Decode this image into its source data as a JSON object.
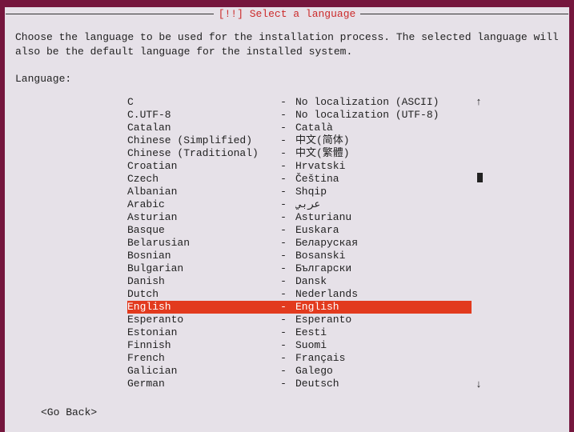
{
  "title": "[!!] Select a language",
  "instruction": "Choose the language to be used for the installation process. The selected language will\nalso be the default language for the installed system.",
  "label": "Language:",
  "go_back": "<Go Back>",
  "separator": "-",
  "scroll": {
    "up": "↑",
    "down": "↓"
  },
  "languages": [
    {
      "name": "C",
      "native": "No localization (ASCII)",
      "selected": false
    },
    {
      "name": "C.UTF-8",
      "native": "No localization (UTF-8)",
      "selected": false
    },
    {
      "name": "Catalan",
      "native": "Català",
      "selected": false
    },
    {
      "name": "Chinese (Simplified)",
      "native": "中文(简体)",
      "selected": false
    },
    {
      "name": "Chinese (Traditional)",
      "native": "中文(繁體)",
      "selected": false
    },
    {
      "name": "Croatian",
      "native": "Hrvatski",
      "selected": false
    },
    {
      "name": "Czech",
      "native": "Čeština",
      "selected": false
    },
    {
      "name": "Albanian",
      "native": "Shqip",
      "selected": false
    },
    {
      "name": "Arabic",
      "native": "عربي",
      "selected": false
    },
    {
      "name": "Asturian",
      "native": "Asturianu",
      "selected": false
    },
    {
      "name": "Basque",
      "native": "Euskara",
      "selected": false
    },
    {
      "name": "Belarusian",
      "native": "Беларуская",
      "selected": false
    },
    {
      "name": "Bosnian",
      "native": "Bosanski",
      "selected": false
    },
    {
      "name": "Bulgarian",
      "native": "Български",
      "selected": false
    },
    {
      "name": "Danish",
      "native": "Dansk",
      "selected": false
    },
    {
      "name": "Dutch",
      "native": "Nederlands",
      "selected": false
    },
    {
      "name": "English",
      "native": "English",
      "selected": true
    },
    {
      "name": "Esperanto",
      "native": "Esperanto",
      "selected": false
    },
    {
      "name": "Estonian",
      "native": "Eesti",
      "selected": false
    },
    {
      "name": "Finnish",
      "native": "Suomi",
      "selected": false
    },
    {
      "name": "French",
      "native": "Français",
      "selected": false
    },
    {
      "name": "Galician",
      "native": "Galego",
      "selected": false
    },
    {
      "name": "German",
      "native": "Deutsch",
      "selected": false
    }
  ]
}
